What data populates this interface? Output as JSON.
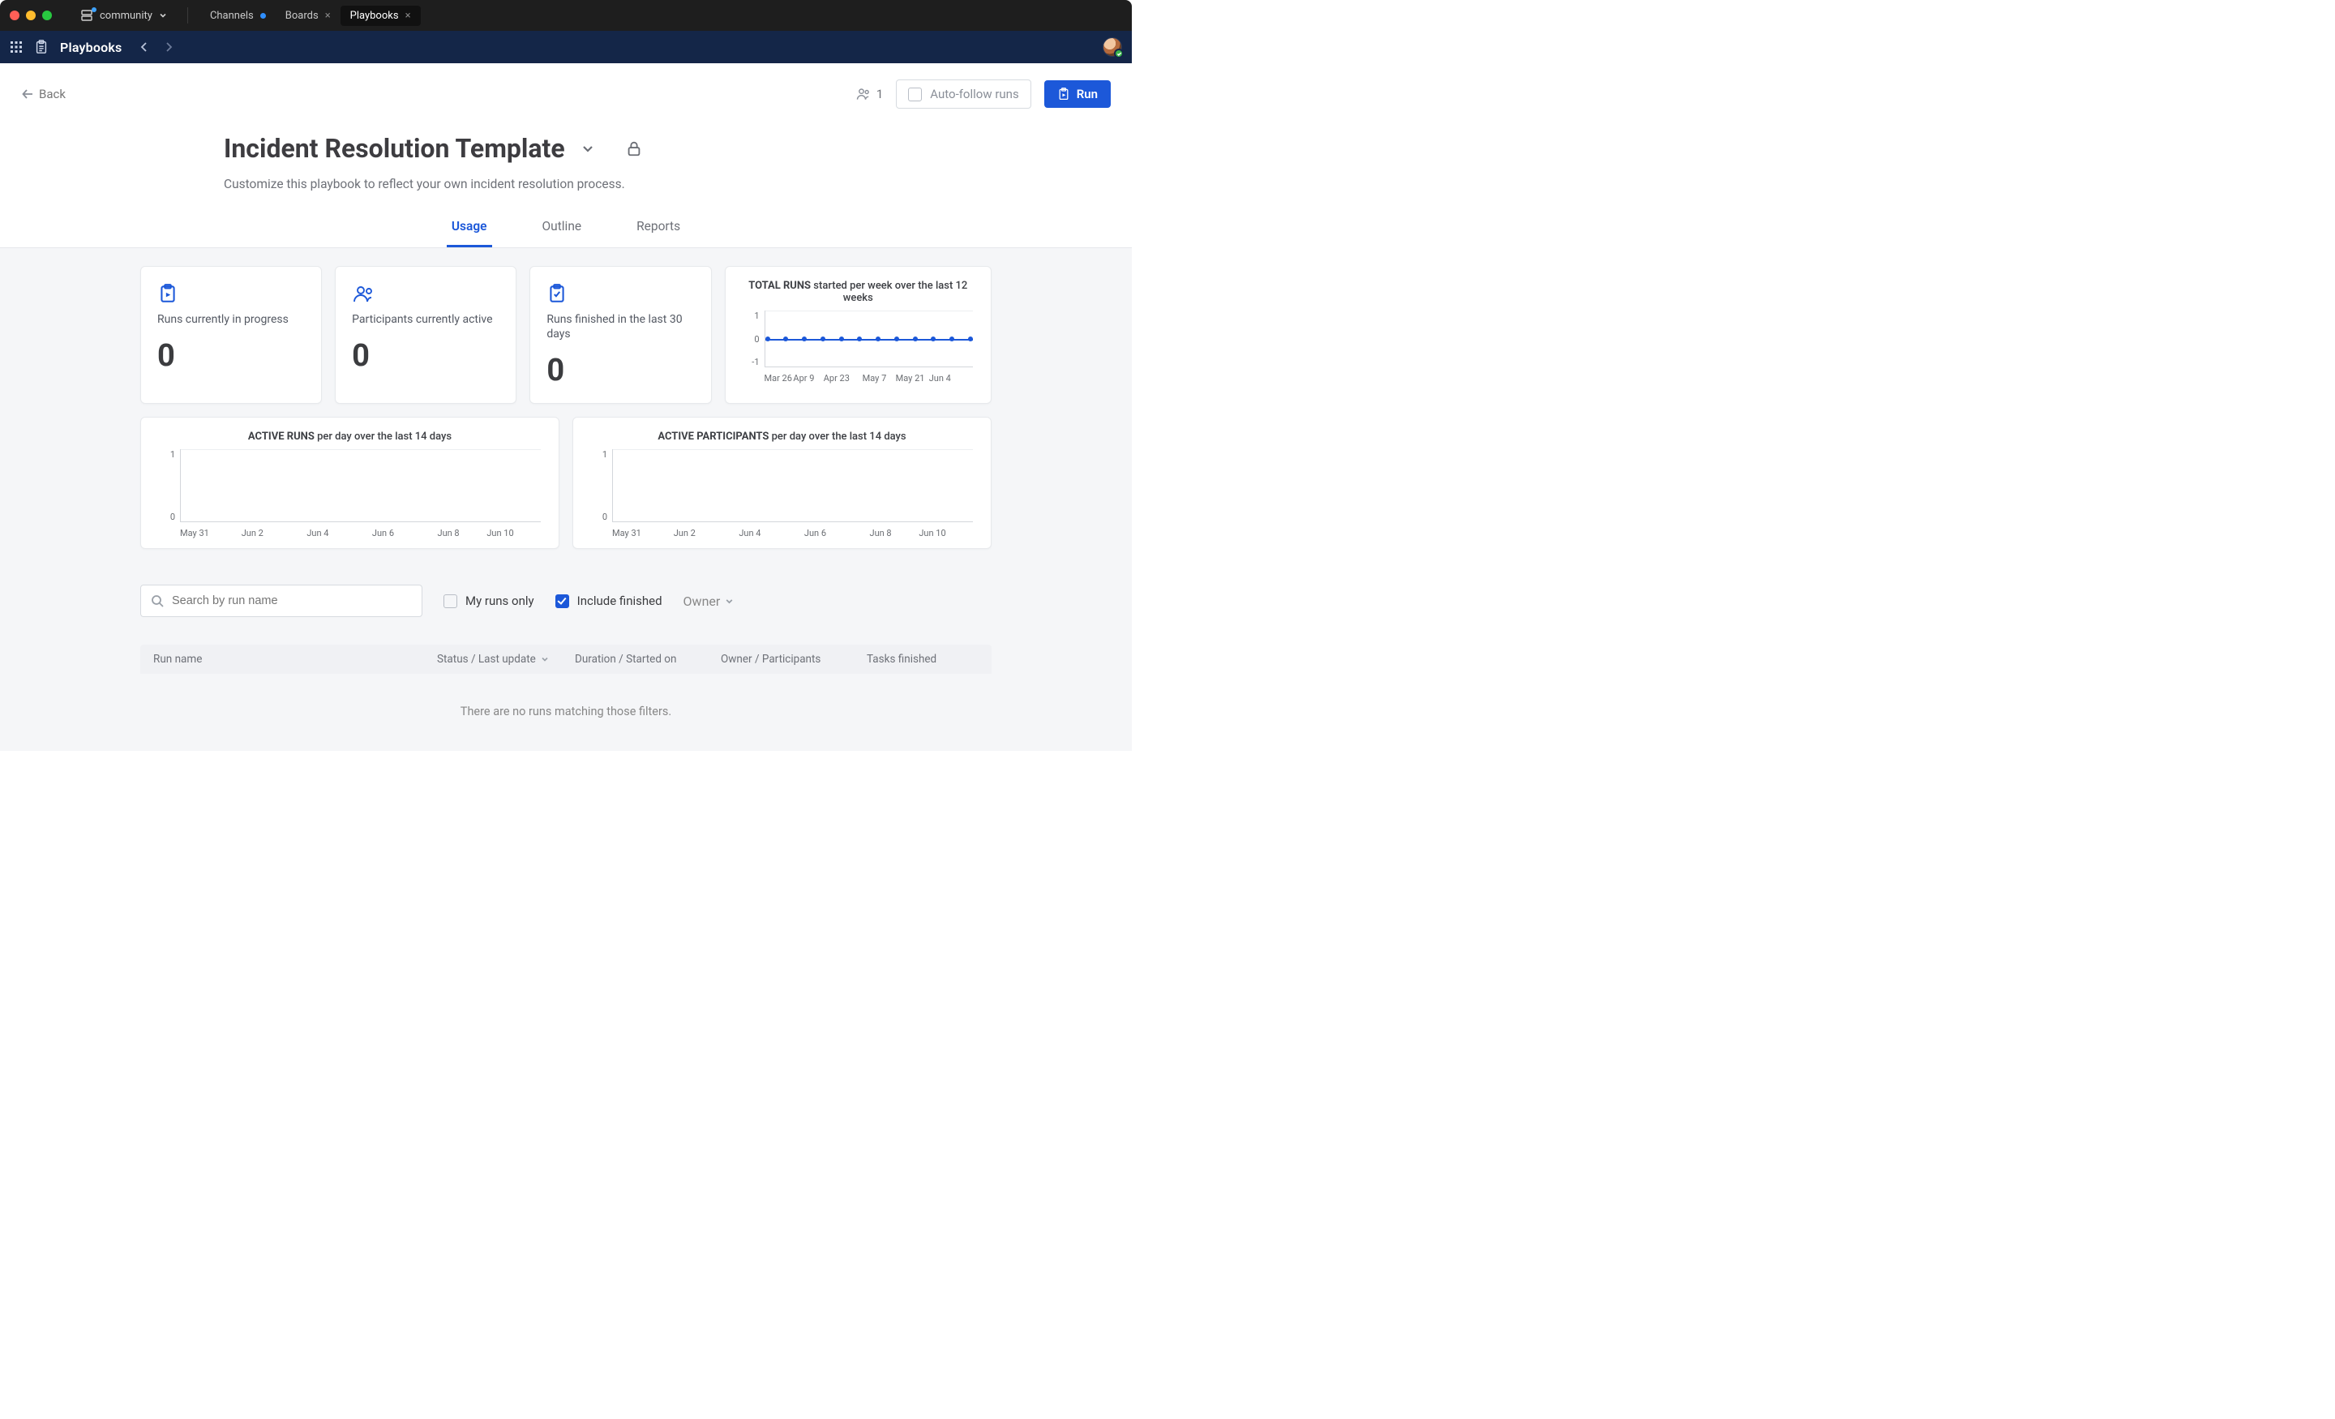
{
  "mac": {
    "workspace": "community",
    "tabs": [
      {
        "label": "Channels",
        "has_badge": true,
        "closable": false
      },
      {
        "label": "Boards",
        "has_badge": false,
        "closable": true
      },
      {
        "label": "Playbooks",
        "has_badge": false,
        "closable": true,
        "active": true
      }
    ]
  },
  "appbar": {
    "title": "Playbooks"
  },
  "header": {
    "back_label": "Back",
    "participants_count": "1",
    "auto_follow_label": "Auto-follow runs",
    "run_label": "Run"
  },
  "title": {
    "text": "Incident Resolution Template",
    "subtitle": "Customize this playbook to reflect your own incident resolution process."
  },
  "tabs": {
    "usage": "Usage",
    "outline": "Outline",
    "reports": "Reports"
  },
  "stats": {
    "runs_in_progress": {
      "label": "Runs currently in progress",
      "value": "0"
    },
    "participants_active": {
      "label": "Participants currently active",
      "value": "0"
    },
    "runs_finished": {
      "label": "Runs finished in the last 30 days",
      "value": "0"
    }
  },
  "chart_data": [
    {
      "id": "total_runs",
      "type": "line",
      "title_bold": "TOTAL RUNS",
      "title_rest": " started per week over the last 12 weeks",
      "categories": [
        "Mar 26",
        "Apr 9",
        "Apr 23",
        "May 7",
        "May 21",
        "Jun 4"
      ],
      "y_ticks": [
        "1",
        "0",
        "-1"
      ],
      "ylim": [
        -1,
        1
      ],
      "series": [
        {
          "name": "Runs",
          "values": [
            0,
            0,
            0,
            0,
            0,
            0,
            0,
            0,
            0,
            0,
            0,
            0
          ]
        }
      ]
    },
    {
      "id": "active_runs",
      "type": "line",
      "title_bold": "ACTIVE RUNS",
      "title_rest": " per day over the last 14 days",
      "categories": [
        "May 31",
        "Jun 2",
        "Jun 4",
        "Jun 6",
        "Jun 8",
        "Jun 10"
      ],
      "y_ticks": [
        "1",
        "0"
      ],
      "ylim": [
        0,
        1
      ],
      "series": [
        {
          "name": "Active runs",
          "values": [
            0,
            0,
            0,
            0,
            0,
            0,
            0,
            0,
            0,
            0,
            0,
            0,
            0,
            0
          ]
        }
      ]
    },
    {
      "id": "active_participants",
      "type": "line",
      "title_bold": "ACTIVE PARTICIPANTS",
      "title_rest": " per day over the last 14 days",
      "categories": [
        "May 31",
        "Jun 2",
        "Jun 4",
        "Jun 6",
        "Jun 8",
        "Jun 10"
      ],
      "y_ticks": [
        "1",
        "0"
      ],
      "ylim": [
        0,
        1
      ],
      "series": [
        {
          "name": "Active participants",
          "values": [
            0,
            0,
            0,
            0,
            0,
            0,
            0,
            0,
            0,
            0,
            0,
            0,
            0,
            0
          ]
        }
      ]
    }
  ],
  "filters": {
    "search_placeholder": "Search by run name",
    "my_runs_label": "My runs only",
    "include_finished_label": "Include finished",
    "owner_label": "Owner"
  },
  "table_head": {
    "run_name": "Run name",
    "status": "Status / Last update",
    "duration": "Duration / Started on",
    "owner": "Owner / Participants",
    "tasks": "Tasks finished"
  },
  "empty_message": "There are no runs matching those filters."
}
